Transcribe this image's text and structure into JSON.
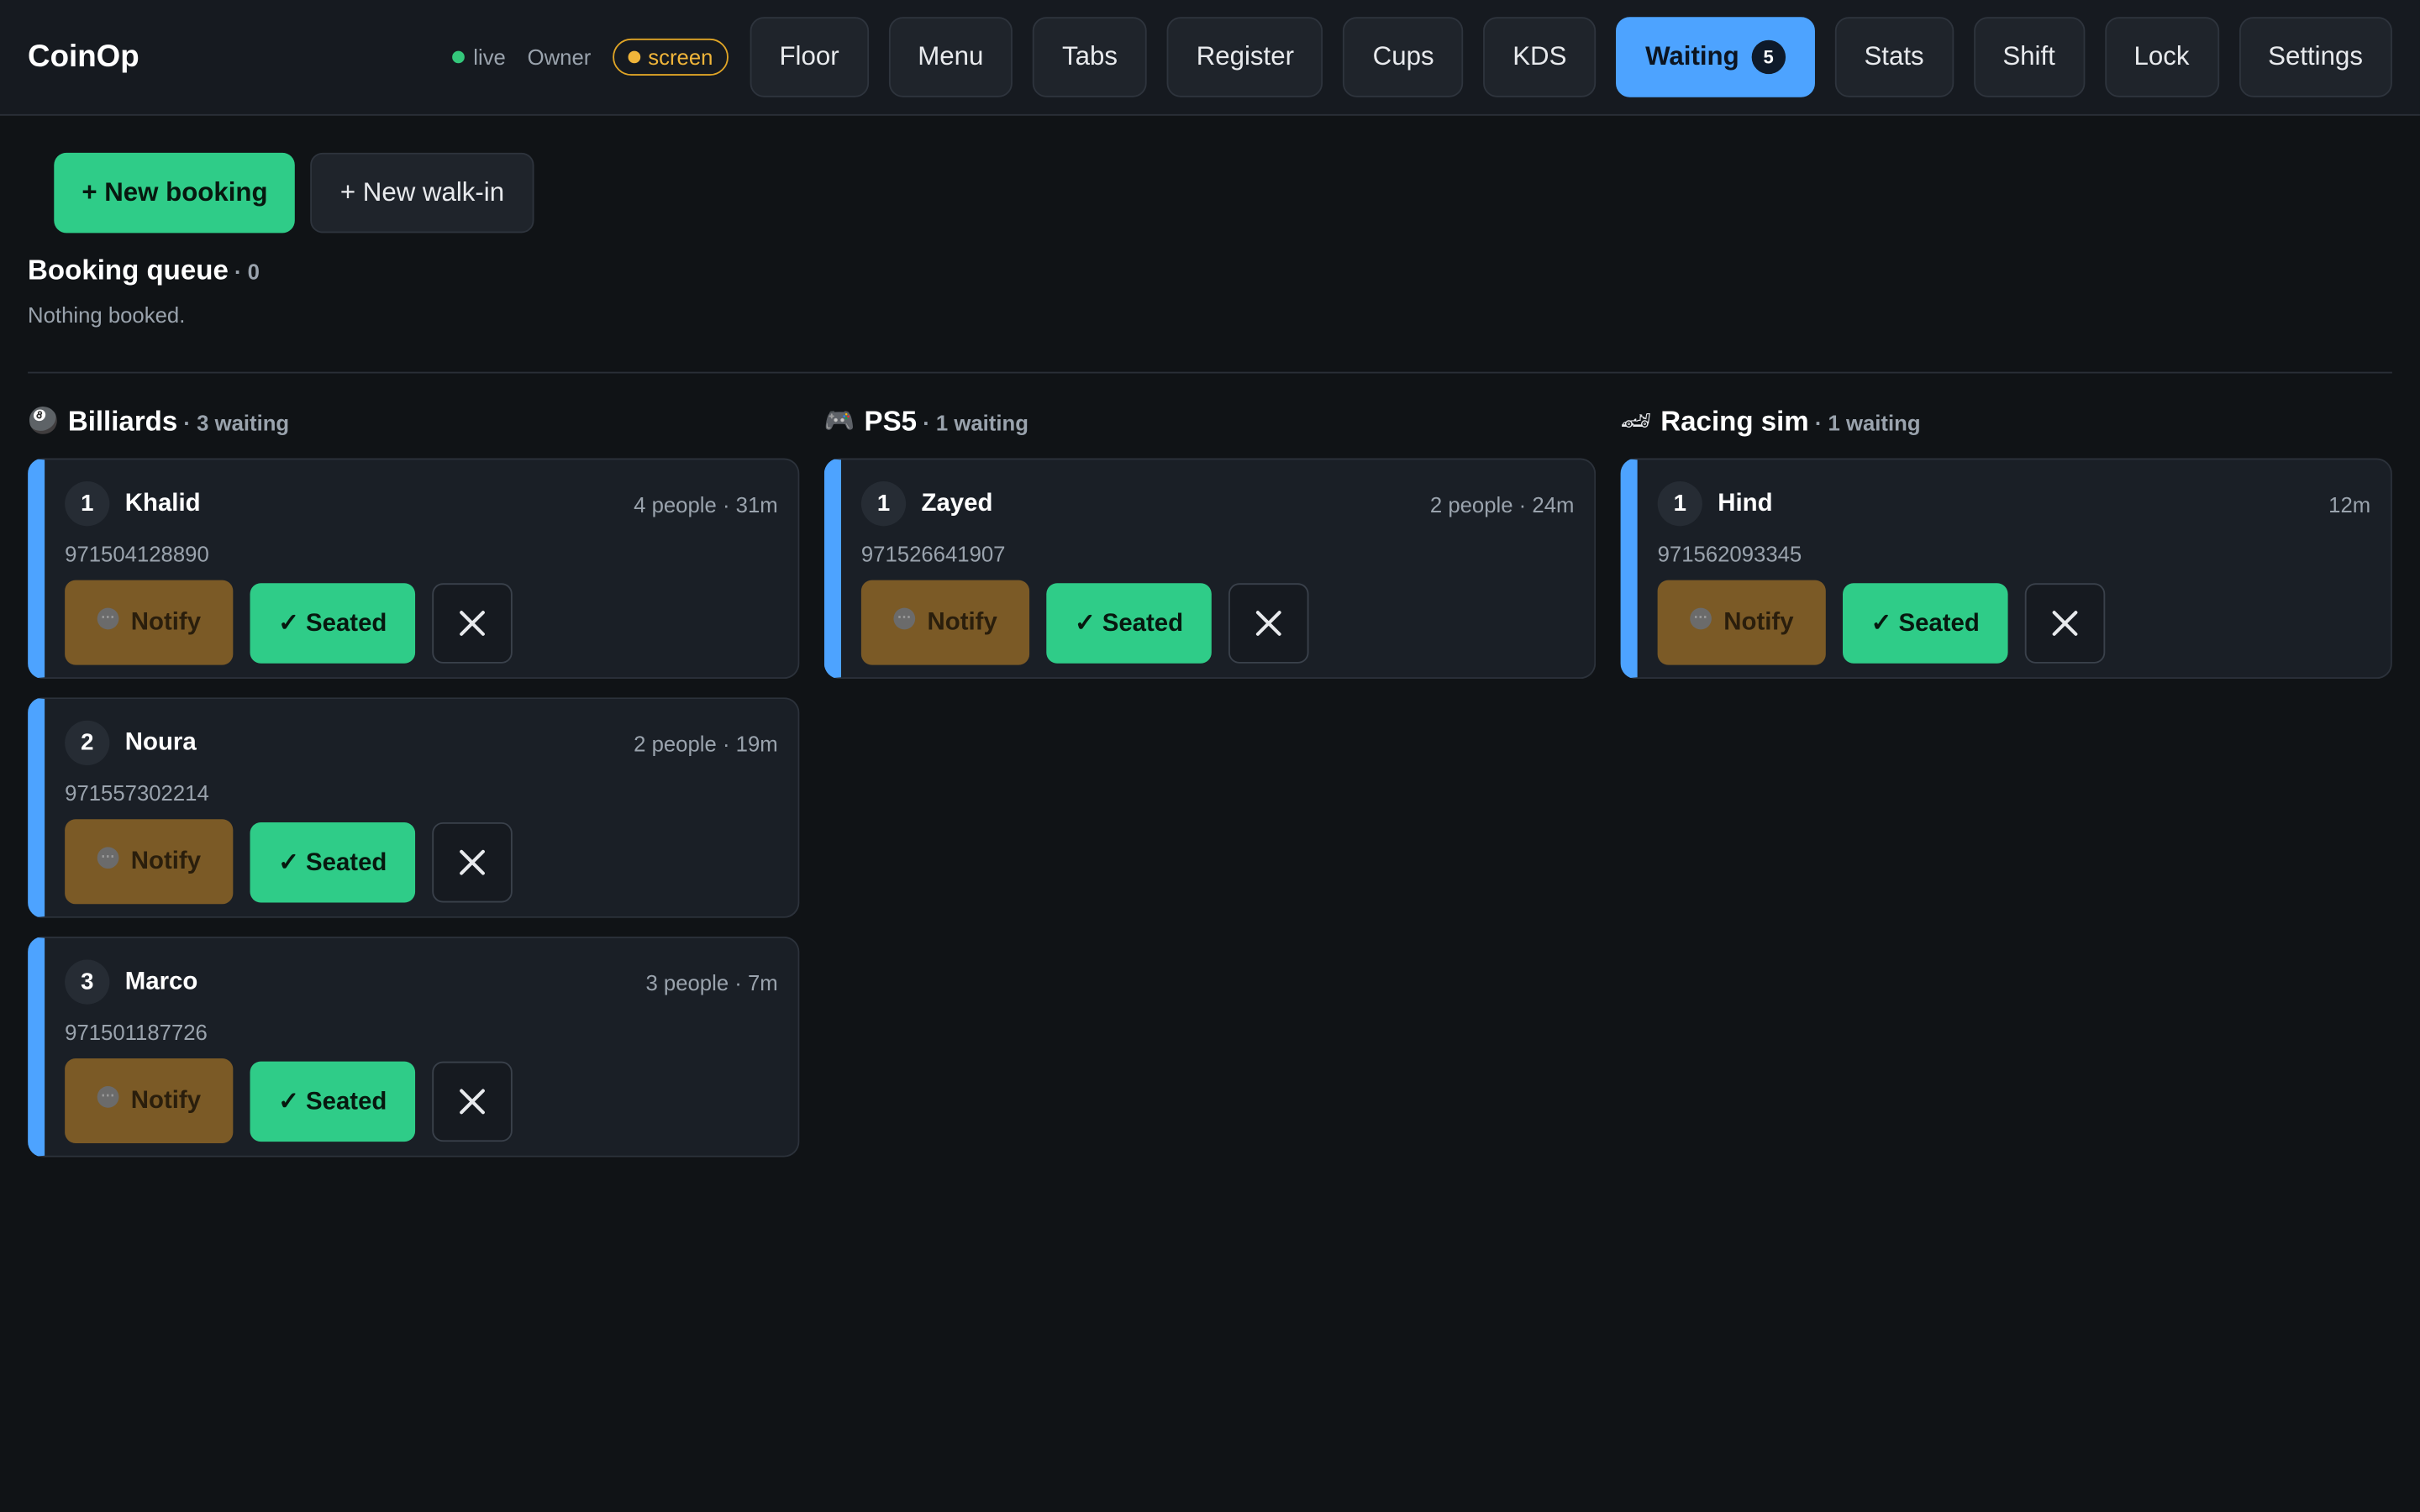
{
  "header": {
    "brand": "CoinOp",
    "status_label": "live",
    "role": "Owner",
    "mode": "screen",
    "nav": [
      {
        "label": "Floor"
      },
      {
        "label": "Menu"
      },
      {
        "label": "Tabs"
      },
      {
        "label": "Register"
      },
      {
        "label": "Cups"
      },
      {
        "label": "KDS"
      },
      {
        "label": "Waiting",
        "badge": "5",
        "active": true
      },
      {
        "label": "Stats"
      },
      {
        "label": "Shift"
      },
      {
        "label": "Lock"
      },
      {
        "label": "Settings"
      }
    ]
  },
  "actions": {
    "new_booking": "+ New booking",
    "new_walkin": "+ New walk-in"
  },
  "queue": {
    "title": "Booking queue",
    "count": " · 0",
    "empty": "Nothing booked."
  },
  "buttons": {
    "notify": "Notify",
    "seated": "✓ Seated"
  },
  "columns": [
    {
      "name": "Billiards",
      "icon": "🎱",
      "count": " · 3 waiting",
      "cards": [
        {
          "pos": "1",
          "name": "Khalid",
          "meta": "4 people · 31m",
          "phone": "971504128890"
        },
        {
          "pos": "2",
          "name": "Noura",
          "meta": "2 people · 19m",
          "phone": "971557302214"
        },
        {
          "pos": "3",
          "name": "Marco",
          "meta": "3 people · 7m",
          "phone": "971501187726"
        }
      ]
    },
    {
      "name": "PS5",
      "icon": "🎮",
      "count": " · 1 waiting",
      "cards": [
        {
          "pos": "1",
          "name": "Zayed",
          "meta": "2 people · 24m",
          "phone": "971526641907"
        }
      ]
    },
    {
      "name": "Racing sim",
      "icon": "🏎",
      "count": " · 1 waiting",
      "cards": [
        {
          "pos": "1",
          "name": "Hind",
          "meta": "12m",
          "phone": "971562093345"
        }
      ]
    }
  ],
  "colors": {
    "accent": "#4da3ff",
    "success": "#2fcc88",
    "warning": "#7b5a26",
    "background": "#101316"
  }
}
